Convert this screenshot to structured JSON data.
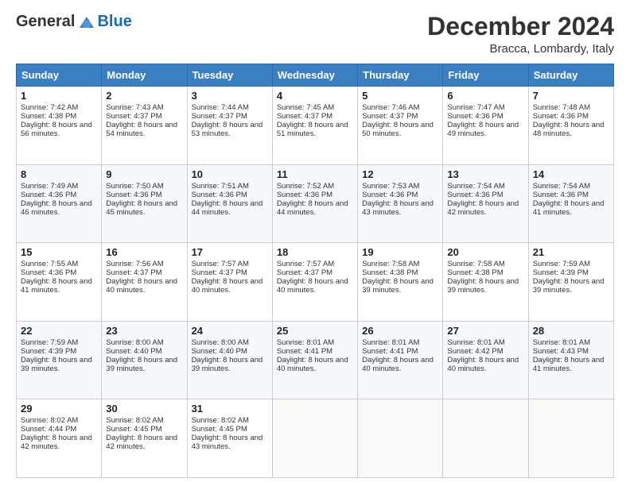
{
  "header": {
    "logo_general": "General",
    "logo_blue": "Blue",
    "month_title": "December 2024",
    "location": "Bracca, Lombardy, Italy"
  },
  "calendar": {
    "days_of_week": [
      "Sunday",
      "Monday",
      "Tuesday",
      "Wednesday",
      "Thursday",
      "Friday",
      "Saturday"
    ],
    "weeks": [
      [
        {
          "day": "",
          "sunrise": "",
          "sunset": "",
          "daylight": ""
        },
        {
          "day": "",
          "sunrise": "",
          "sunset": "",
          "daylight": ""
        },
        {
          "day": "",
          "sunrise": "",
          "sunset": "",
          "daylight": ""
        },
        {
          "day": "",
          "sunrise": "",
          "sunset": "",
          "daylight": ""
        },
        {
          "day": "",
          "sunrise": "",
          "sunset": "",
          "daylight": ""
        },
        {
          "day": "",
          "sunrise": "",
          "sunset": "",
          "daylight": ""
        },
        {
          "day": "",
          "sunrise": "",
          "sunset": "",
          "daylight": ""
        }
      ],
      [
        {
          "day": "1",
          "sunrise": "Sunrise: 7:42 AM",
          "sunset": "Sunset: 4:38 PM",
          "daylight": "Daylight: 8 hours and 56 minutes."
        },
        {
          "day": "2",
          "sunrise": "Sunrise: 7:43 AM",
          "sunset": "Sunset: 4:37 PM",
          "daylight": "Daylight: 8 hours and 54 minutes."
        },
        {
          "day": "3",
          "sunrise": "Sunrise: 7:44 AM",
          "sunset": "Sunset: 4:37 PM",
          "daylight": "Daylight: 8 hours and 53 minutes."
        },
        {
          "day": "4",
          "sunrise": "Sunrise: 7:45 AM",
          "sunset": "Sunset: 4:37 PM",
          "daylight": "Daylight: 8 hours and 51 minutes."
        },
        {
          "day": "5",
          "sunrise": "Sunrise: 7:46 AM",
          "sunset": "Sunset: 4:37 PM",
          "daylight": "Daylight: 8 hours and 50 minutes."
        },
        {
          "day": "6",
          "sunrise": "Sunrise: 7:47 AM",
          "sunset": "Sunset: 4:36 PM",
          "daylight": "Daylight: 8 hours and 49 minutes."
        },
        {
          "day": "7",
          "sunrise": "Sunrise: 7:48 AM",
          "sunset": "Sunset: 4:36 PM",
          "daylight": "Daylight: 8 hours and 48 minutes."
        }
      ],
      [
        {
          "day": "8",
          "sunrise": "Sunrise: 7:49 AM",
          "sunset": "Sunset: 4:36 PM",
          "daylight": "Daylight: 8 hours and 46 minutes."
        },
        {
          "day": "9",
          "sunrise": "Sunrise: 7:50 AM",
          "sunset": "Sunset: 4:36 PM",
          "daylight": "Daylight: 8 hours and 45 minutes."
        },
        {
          "day": "10",
          "sunrise": "Sunrise: 7:51 AM",
          "sunset": "Sunset: 4:36 PM",
          "daylight": "Daylight: 8 hours and 44 minutes."
        },
        {
          "day": "11",
          "sunrise": "Sunrise: 7:52 AM",
          "sunset": "Sunset: 4:36 PM",
          "daylight": "Daylight: 8 hours and 44 minutes."
        },
        {
          "day": "12",
          "sunrise": "Sunrise: 7:53 AM",
          "sunset": "Sunset: 4:36 PM",
          "daylight": "Daylight: 8 hours and 43 minutes."
        },
        {
          "day": "13",
          "sunrise": "Sunrise: 7:54 AM",
          "sunset": "Sunset: 4:36 PM",
          "daylight": "Daylight: 8 hours and 42 minutes."
        },
        {
          "day": "14",
          "sunrise": "Sunrise: 7:54 AM",
          "sunset": "Sunset: 4:36 PM",
          "daylight": "Daylight: 8 hours and 41 minutes."
        }
      ],
      [
        {
          "day": "15",
          "sunrise": "Sunrise: 7:55 AM",
          "sunset": "Sunset: 4:36 PM",
          "daylight": "Daylight: 8 hours and 41 minutes."
        },
        {
          "day": "16",
          "sunrise": "Sunrise: 7:56 AM",
          "sunset": "Sunset: 4:37 PM",
          "daylight": "Daylight: 8 hours and 40 minutes."
        },
        {
          "day": "17",
          "sunrise": "Sunrise: 7:57 AM",
          "sunset": "Sunset: 4:37 PM",
          "daylight": "Daylight: 8 hours and 40 minutes."
        },
        {
          "day": "18",
          "sunrise": "Sunrise: 7:57 AM",
          "sunset": "Sunset: 4:37 PM",
          "daylight": "Daylight: 8 hours and 40 minutes."
        },
        {
          "day": "19",
          "sunrise": "Sunrise: 7:58 AM",
          "sunset": "Sunset: 4:38 PM",
          "daylight": "Daylight: 8 hours and 39 minutes."
        },
        {
          "day": "20",
          "sunrise": "Sunrise: 7:58 AM",
          "sunset": "Sunset: 4:38 PM",
          "daylight": "Daylight: 8 hours and 39 minutes."
        },
        {
          "day": "21",
          "sunrise": "Sunrise: 7:59 AM",
          "sunset": "Sunset: 4:39 PM",
          "daylight": "Daylight: 8 hours and 39 minutes."
        }
      ],
      [
        {
          "day": "22",
          "sunrise": "Sunrise: 7:59 AM",
          "sunset": "Sunset: 4:39 PM",
          "daylight": "Daylight: 8 hours and 39 minutes."
        },
        {
          "day": "23",
          "sunrise": "Sunrise: 8:00 AM",
          "sunset": "Sunset: 4:40 PM",
          "daylight": "Daylight: 8 hours and 39 minutes."
        },
        {
          "day": "24",
          "sunrise": "Sunrise: 8:00 AM",
          "sunset": "Sunset: 4:40 PM",
          "daylight": "Daylight: 8 hours and 39 minutes."
        },
        {
          "day": "25",
          "sunrise": "Sunrise: 8:01 AM",
          "sunset": "Sunset: 4:41 PM",
          "daylight": "Daylight: 8 hours and 40 minutes."
        },
        {
          "day": "26",
          "sunrise": "Sunrise: 8:01 AM",
          "sunset": "Sunset: 4:41 PM",
          "daylight": "Daylight: 8 hours and 40 minutes."
        },
        {
          "day": "27",
          "sunrise": "Sunrise: 8:01 AM",
          "sunset": "Sunset: 4:42 PM",
          "daylight": "Daylight: 8 hours and 40 minutes."
        },
        {
          "day": "28",
          "sunrise": "Sunrise: 8:01 AM",
          "sunset": "Sunset: 4:43 PM",
          "daylight": "Daylight: 8 hours and 41 minutes."
        }
      ],
      [
        {
          "day": "29",
          "sunrise": "Sunrise: 8:02 AM",
          "sunset": "Sunset: 4:44 PM",
          "daylight": "Daylight: 8 hours and 42 minutes."
        },
        {
          "day": "30",
          "sunrise": "Sunrise: 8:02 AM",
          "sunset": "Sunset: 4:45 PM",
          "daylight": "Daylight: 8 hours and 42 minutes."
        },
        {
          "day": "31",
          "sunrise": "Sunrise: 8:02 AM",
          "sunset": "Sunset: 4:45 PM",
          "daylight": "Daylight: 8 hours and 43 minutes."
        },
        {
          "day": "",
          "sunrise": "",
          "sunset": "",
          "daylight": ""
        },
        {
          "day": "",
          "sunrise": "",
          "sunset": "",
          "daylight": ""
        },
        {
          "day": "",
          "sunrise": "",
          "sunset": "",
          "daylight": ""
        },
        {
          "day": "",
          "sunrise": "",
          "sunset": "",
          "daylight": ""
        }
      ]
    ]
  }
}
